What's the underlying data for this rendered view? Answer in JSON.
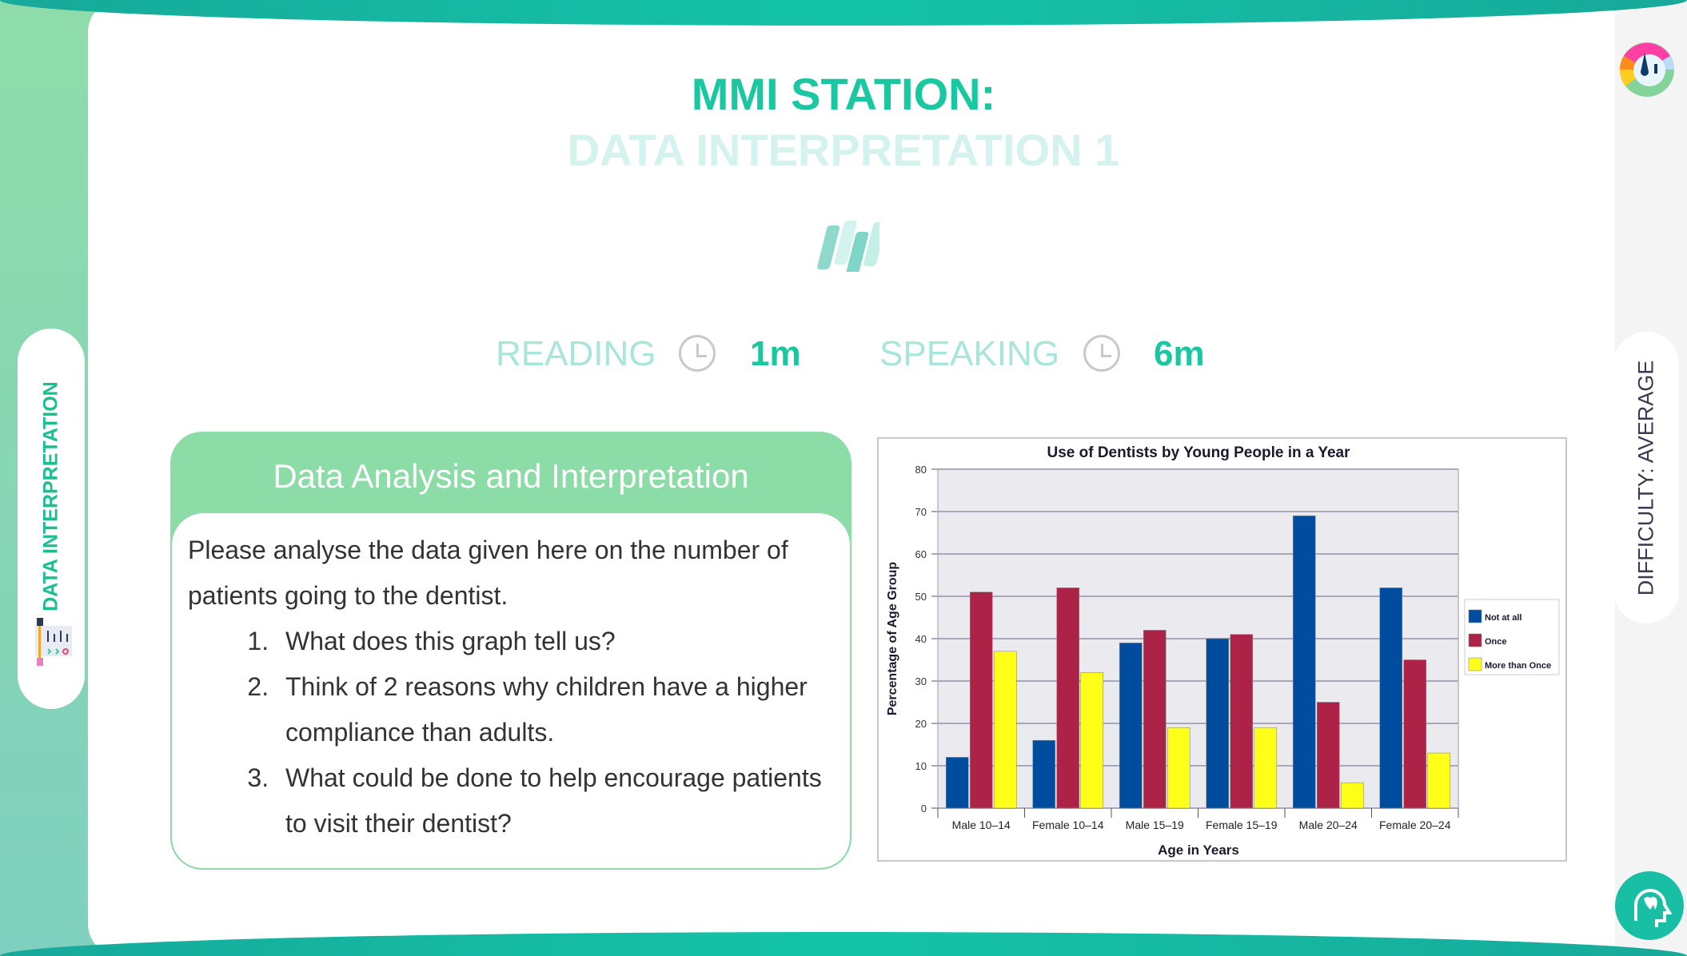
{
  "header": {
    "title": "MMI STATION:",
    "subtitle": "DATA INTERPRETATION 1"
  },
  "timing": {
    "reading_label": "READING",
    "reading_time": "1m",
    "speaking_label": "SPEAKING",
    "speaking_time": "6m"
  },
  "sidebar": {
    "category": "DATA INTERPRETATION",
    "difficulty": "DIFFICULTY: AVERAGE"
  },
  "card": {
    "title": "Data Analysis and Interpretation",
    "intro": "Please analyse the data given here on the number of patients going to the dentist.",
    "questions": [
      "What does this graph tell us?",
      "Think of 2 reasons why children have a higher compliance than adults.",
      "What could be done to help encourage patients to visit their dentist?"
    ]
  },
  "colors": {
    "accent": "#19c8a0",
    "header_green": "#8cdca8",
    "teal_bar": "#14c4a8"
  },
  "icons": {
    "logo": "gauge-logo-icon",
    "brand": "slashes-icon",
    "clock": "clock-icon",
    "category": "chart-document-icon",
    "brain": "head-tooth-icon"
  },
  "chart_data": {
    "type": "bar",
    "title": "Use of Dentists by Young People in a Year",
    "xlabel": "Age in Years",
    "ylabel": "Percentage of Age Group",
    "ylim": [
      0,
      80
    ],
    "yticks": [
      0,
      10,
      20,
      30,
      40,
      50,
      60,
      70,
      80
    ],
    "grid": true,
    "legend": "right",
    "categories": [
      "Male 10–14",
      "Female 10–14",
      "Male 15–19",
      "Female 15–19",
      "Male 20–24",
      "Female 20–24"
    ],
    "series": [
      {
        "name": "Not at all",
        "color": "#004c9e",
        "values": [
          12,
          16,
          39,
          40,
          69,
          52
        ]
      },
      {
        "name": "Once",
        "color": "#ad2347",
        "values": [
          51,
          52,
          42,
          41,
          25,
          35
        ]
      },
      {
        "name": "More than Once",
        "color": "#ffff1a",
        "values": [
          37,
          32,
          19,
          19,
          6,
          13
        ]
      }
    ]
  }
}
